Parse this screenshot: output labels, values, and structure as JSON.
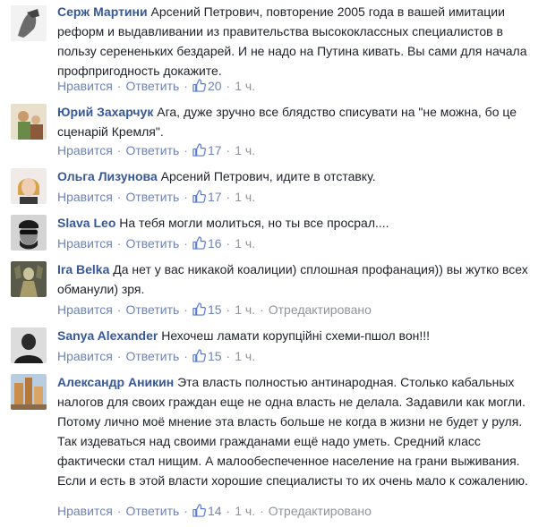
{
  "actions": {
    "like_label": "Нравится",
    "reply_label": "Ответить",
    "separator": "·",
    "edited_label": "Отредактировано"
  },
  "comments": [
    {
      "author": "Серж Мартини",
      "text": "Арсений Петрович, повторение 2005 года в вашей имитации реформ и выдавливании из правительства высококлассных специалистов в пользу серененьких бездарей. И не надо на Путина кивать. Вы сами для начала профпригодность докажите.",
      "likes": "20",
      "time": "1 ч.",
      "edited": false,
      "avatar_colors": [
        "#f2f2f2",
        "#6b6b6b"
      ]
    },
    {
      "author": "Юрий Захарчук",
      "text": "Ага, дуже зручно все блядство списувати на \"не можна, бо це сценарій Кремля\".",
      "likes": "17",
      "time": "1 ч.",
      "edited": false,
      "avatar_colors": [
        "#c9b38a",
        "#7a6a4a"
      ]
    },
    {
      "author": "Ольга Лизунова",
      "text": "Арсений Петрович, идите в отставку.",
      "likes": "17",
      "time": "1 ч.",
      "edited": false,
      "avatar_colors": [
        "#e8d7c8",
        "#d6a24a"
      ]
    },
    {
      "author": "Slava Leo",
      "text": "На тебя могли молиться, но ты все просрал....",
      "likes": "16",
      "time": "1 ч.",
      "edited": false,
      "avatar_colors": [
        "#d4d4d4",
        "#222222"
      ]
    },
    {
      "author": "Ira Belka",
      "text": "Да нет у вас никакой коалиции) сплошная профанация)) вы жутко всех обманули) зря.",
      "likes": "15",
      "time": "1 ч.",
      "edited": true,
      "avatar_colors": [
        "#6b6b5a",
        "#c9c29a"
      ]
    },
    {
      "author": "Sanya Alexander",
      "text": "Нехочеш ламати корупційні схеми-пшол вон!!!",
      "likes": "15",
      "time": "1 ч.",
      "edited": false,
      "avatar_colors": [
        "#dcdcdc",
        "#1f1f1f"
      ]
    },
    {
      "author": "Александр Аникин",
      "text": "Эта власть полностью антинародная. Столько кабальных налогов для своих граждан еще не одна власть не делала. Задавили как могли. Потому лично моё мнение эта власть больше не когда в жизни не будет у руля. Так издеваться над своими гражданами ещё надо уметь. Средний класс фактически стал нищим. А малообеспеченное население на грани выживания. Если и есть в этой власти хорошие специалисты то их очень мало к сожалению.",
      "likes": "14",
      "time": "1 ч.",
      "edited": true,
      "avatar_colors": [
        "#b9cde0",
        "#c98f4a"
      ]
    }
  ]
}
